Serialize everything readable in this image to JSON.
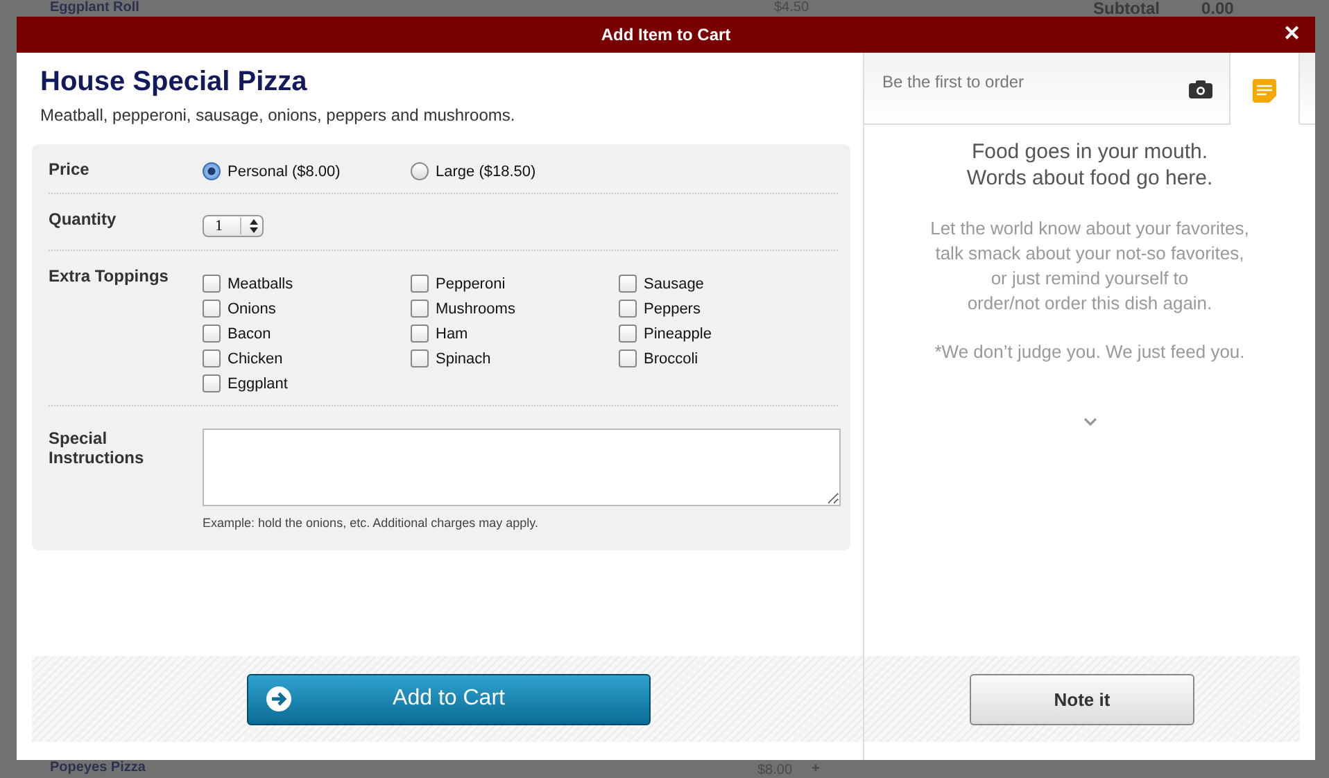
{
  "background_page": {
    "top_item": {
      "name": "Eggplant Roll",
      "price": "$4.50"
    },
    "subtotal": {
      "label": "Subtotal",
      "value": "0.00"
    },
    "bottom_item": {
      "name": "Popeyes Pizza",
      "price": "$8.00",
      "add": "+"
    }
  },
  "dialog": {
    "title": "Add Item to Cart",
    "close": "✕"
  },
  "item": {
    "name": "House Special Pizza",
    "description": "Meatball, pepperoni, sausage, onions, peppers and mushrooms."
  },
  "form": {
    "price": {
      "label": "Price",
      "options": [
        {
          "label": "Personal ($8.00)",
          "selected": true
        },
        {
          "label": "Large ($18.50)",
          "selected": false
        }
      ]
    },
    "quantity": {
      "label": "Quantity",
      "value": "1"
    },
    "toppings": {
      "label": "Extra Toppings",
      "options": [
        {
          "label": "Meatballs",
          "checked": false
        },
        {
          "label": "Pepperoni",
          "checked": false
        },
        {
          "label": "Sausage",
          "checked": false
        },
        {
          "label": "Onions",
          "checked": false
        },
        {
          "label": "Mushrooms",
          "checked": false
        },
        {
          "label": "Peppers",
          "checked": false
        },
        {
          "label": "Bacon",
          "checked": false
        },
        {
          "label": "Ham",
          "checked": false
        },
        {
          "label": "Pineapple",
          "checked": false
        },
        {
          "label": "Chicken",
          "checked": false
        },
        {
          "label": "Spinach",
          "checked": false
        },
        {
          "label": "Broccoli",
          "checked": false
        },
        {
          "label": "Eggplant",
          "checked": false
        }
      ]
    },
    "instructions": {
      "label": "Special Instructions",
      "hint": "Example: hold the onions, etc. Additional charges may apply."
    }
  },
  "add_button": "Add to Cart",
  "notes": {
    "tabs": [
      {
        "kind": "orders",
        "label": "Be the first to order",
        "selected": false
      },
      {
        "kind": "notes",
        "selected": true
      }
    ],
    "headline": "Food goes in your mouth.\nWords about food go here.",
    "body": "Let the world know about your favorites,\ntalk smack about your not-so favorites,\nor just remind yourself to\norder/not order this dish again.",
    "footnote": "*We don’t judge you. We just feed you.",
    "button": "Note it"
  }
}
